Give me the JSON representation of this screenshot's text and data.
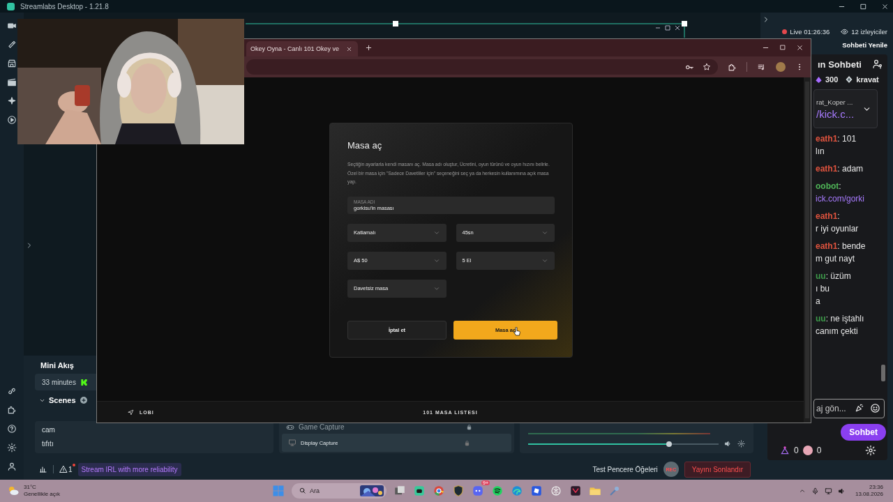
{
  "app": {
    "title": "Streamlabs Desktop - 1.21.8"
  },
  "stream": {
    "live": "Live 01:26:36",
    "viewers": "12 izleyiciler",
    "refresh": "Sohbeti Yenile"
  },
  "browser": {
    "tab": "Okey Oyna - Canlı 101 Okey ve",
    "modal": {
      "title": "Masa aç",
      "description": "Seçtiğin ayarlarla kendi masanı aç. Masa adı oluştur, Ücretini, oyun türünü ve oyun hızını belirle. Özel bir masa için \"Sadece Davetliler için\" seçeneğini seç ya da herkesin kullanımına açık masa yap.",
      "name_field": {
        "label": "MASA ADI",
        "value": "gorkisu'in masası"
      },
      "selects": [
        "Katlamalı",
        "45sn",
        "A$ 50",
        "5 El",
        "Davetsiz masa"
      ],
      "buttons": [
        {
          "label": "İptal et",
          "kind": "secondary"
        },
        {
          "label": "Masa aç",
          "kind": "primary"
        }
      ]
    },
    "bottom_nav": {
      "left": "LOBI",
      "center": "101 MASA LISTESI"
    }
  },
  "mini_feed": {
    "title": "Mini Akış",
    "item": "33 minutes"
  },
  "scenes": {
    "title": "Scenes",
    "items": [
      "cam",
      "tıfıtı"
    ]
  },
  "sources": [
    {
      "label": "Game Capture",
      "kind": "game",
      "selected": false
    },
    {
      "label": "Display Capture",
      "kind": "display",
      "selected": true
    }
  ],
  "mixer": {
    "level": 0.74
  },
  "chat": {
    "title": "ın Sohbeti",
    "stats": [
      {
        "kind": "gem",
        "value": "300"
      },
      {
        "kind": "badge",
        "value": "kravat"
      }
    ],
    "pinned": {
      "user": "rat_Koper ...",
      "text": "/kick.c..."
    },
    "messages": [
      {
        "user": "eath1",
        "color": "#e0533e",
        "lines": [
          ": 101",
          "lın"
        ]
      },
      {
        "user": "eath1",
        "color": "#e0533e",
        "lines": [
          ": adam"
        ]
      },
      {
        "user": "oobot",
        "color": "#4fb457",
        "lines": [
          ":"
        ],
        "link": "ick.com/gorki"
      },
      {
        "user": "eath1",
        "color": "#e0533e",
        "lines": [
          ":",
          "r iyi oyunlar"
        ]
      },
      {
        "user": "eath1",
        "color": "#e0533e",
        "lines": [
          ": bende",
          "m gut nayt"
        ]
      },
      {
        "user": "uu",
        "color": "#3d9a4a",
        "lines": [
          ": üzüm",
          "ı bu",
          "a"
        ]
      },
      {
        "user": "uu",
        "color": "#3d9a4a",
        "lines": [
          ": ne iştahlı",
          "canım çekti"
        ]
      }
    ],
    "input": {
      "placeholder": "aj gön..."
    },
    "send": "Sohbet",
    "counters": [
      {
        "kind": "drop",
        "value": "0"
      },
      {
        "kind": "coin",
        "value": "0"
      }
    ]
  },
  "footer": {
    "alerts": "1",
    "promo": "Stream IRL with more reliability",
    "test": "Test Pencere Öğeleri",
    "rec": "REC",
    "end": "Yayını Sonlandır"
  },
  "taskbar": {
    "temp": "31°C",
    "weather": "Genellikle açık",
    "search": {
      "placeholder": "Ara"
    },
    "badge": "9+",
    "time": "23:36",
    "date": "13.08.2026"
  }
}
